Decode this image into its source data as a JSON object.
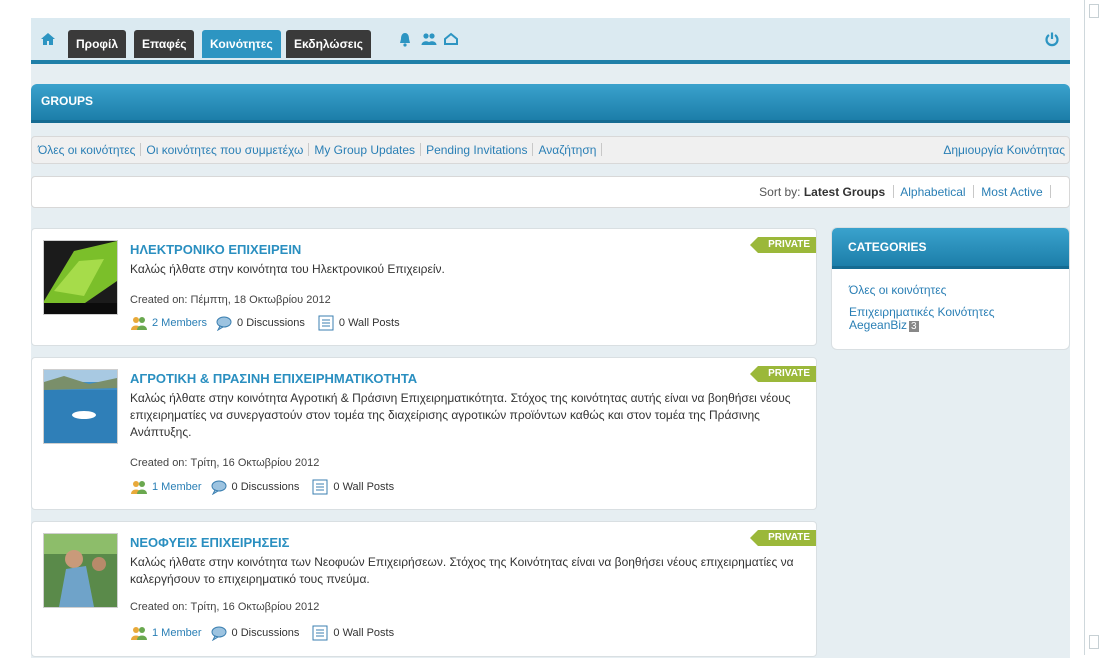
{
  "toolbar": {
    "tabs": [
      {
        "label": "Προφίλ"
      },
      {
        "label": "Επαφές"
      },
      {
        "label": "Κοινότητες"
      },
      {
        "label": "Εκδηλώσεις"
      }
    ],
    "icons": [
      "home-icon",
      "bell-icon",
      "friends-icon",
      "inbox-icon",
      "power-icon"
    ]
  },
  "groups_header": {
    "title": "GROUPS"
  },
  "filter_nav": {
    "items": [
      "Όλες οι κοινότητες",
      "Οι κοινότητες που συμμετέχω",
      "My Group Updates",
      "Pending Invitations",
      "Αναζήτηση"
    ],
    "create": "Δημιουργία Κοινότητας"
  },
  "sort": {
    "label": "Sort by:",
    "current": "Latest Groups",
    "options": [
      "Alphabetical",
      "Most Active"
    ]
  },
  "groups": [
    {
      "title": "ΗΛΕΚΤΡΟΝΙΚΟ ΕΠΙΧΕΙΡΕΙΝ",
      "description": "Καλώς ήλθατε στην κοινότητα του Ηλεκτρονικού Επιχειρείν.",
      "created": "Created on: Πέμπτη, 18 Οκτωβρίου 2012",
      "members": "2 Members",
      "discussions": "0 Discussions",
      "wall_posts": "0 Wall Posts",
      "badge": "PRIVATE"
    },
    {
      "title": "ΑΓΡΟΤΙΚΗ & ΠΡΑΣΙΝΗ ΕΠΙΧΕΙΡΗΜΑΤΙΚΟΤΗΤΑ",
      "description": "Καλώς ήλθατε στην κοινότητα Αγροτική & Πράσινη Επιχειρηματικότητα. Στόχος της κοινότητας αυτής είναι να βοηθήσει νέους επιχειρηματίες να συνεργαστούν στον τομέα της διαχείρισης αγροτικών προϊόντων καθώς και στον τομέα της Πράσινης Ανάπτυξης.",
      "created": "Created on: Τρίτη, 16 Οκτωβρίου 2012",
      "members": "1 Member",
      "discussions": "0 Discussions",
      "wall_posts": "0 Wall Posts",
      "badge": "PRIVATE"
    },
    {
      "title": "ΝΕΟΦΥΕΙΣ ΕΠΙΧΕΙΡΗΣΕΙΣ",
      "description": "Καλώς ήλθατε στην κοινότητα των Νεοφυών Επιχειρήσεων. Στόχος της Κοινότητας είναι να βοηθήσει νέους επιχειρηματίες να καλεργήσουν το επιχειρηματικό τους πνεύμα.",
      "created": "Created on: Τρίτη, 16 Οκτωβρίου 2012",
      "members": "1 Member",
      "discussions": "0 Discussions",
      "wall_posts": "0 Wall Posts",
      "badge": "PRIVATE"
    }
  ],
  "categories": {
    "title": "CATEGORIES",
    "items": [
      {
        "label": "Όλες οι κοινότητες"
      },
      {
        "label": "Επιχειρηματικές Κοινότητες AegeanBiz",
        "count": "3"
      }
    ]
  },
  "colors": {
    "accent": "#2d95c2",
    "tab_dark": "#3a3a3a",
    "link": "#2a7fb5",
    "private_badge": "#9bb83a"
  }
}
